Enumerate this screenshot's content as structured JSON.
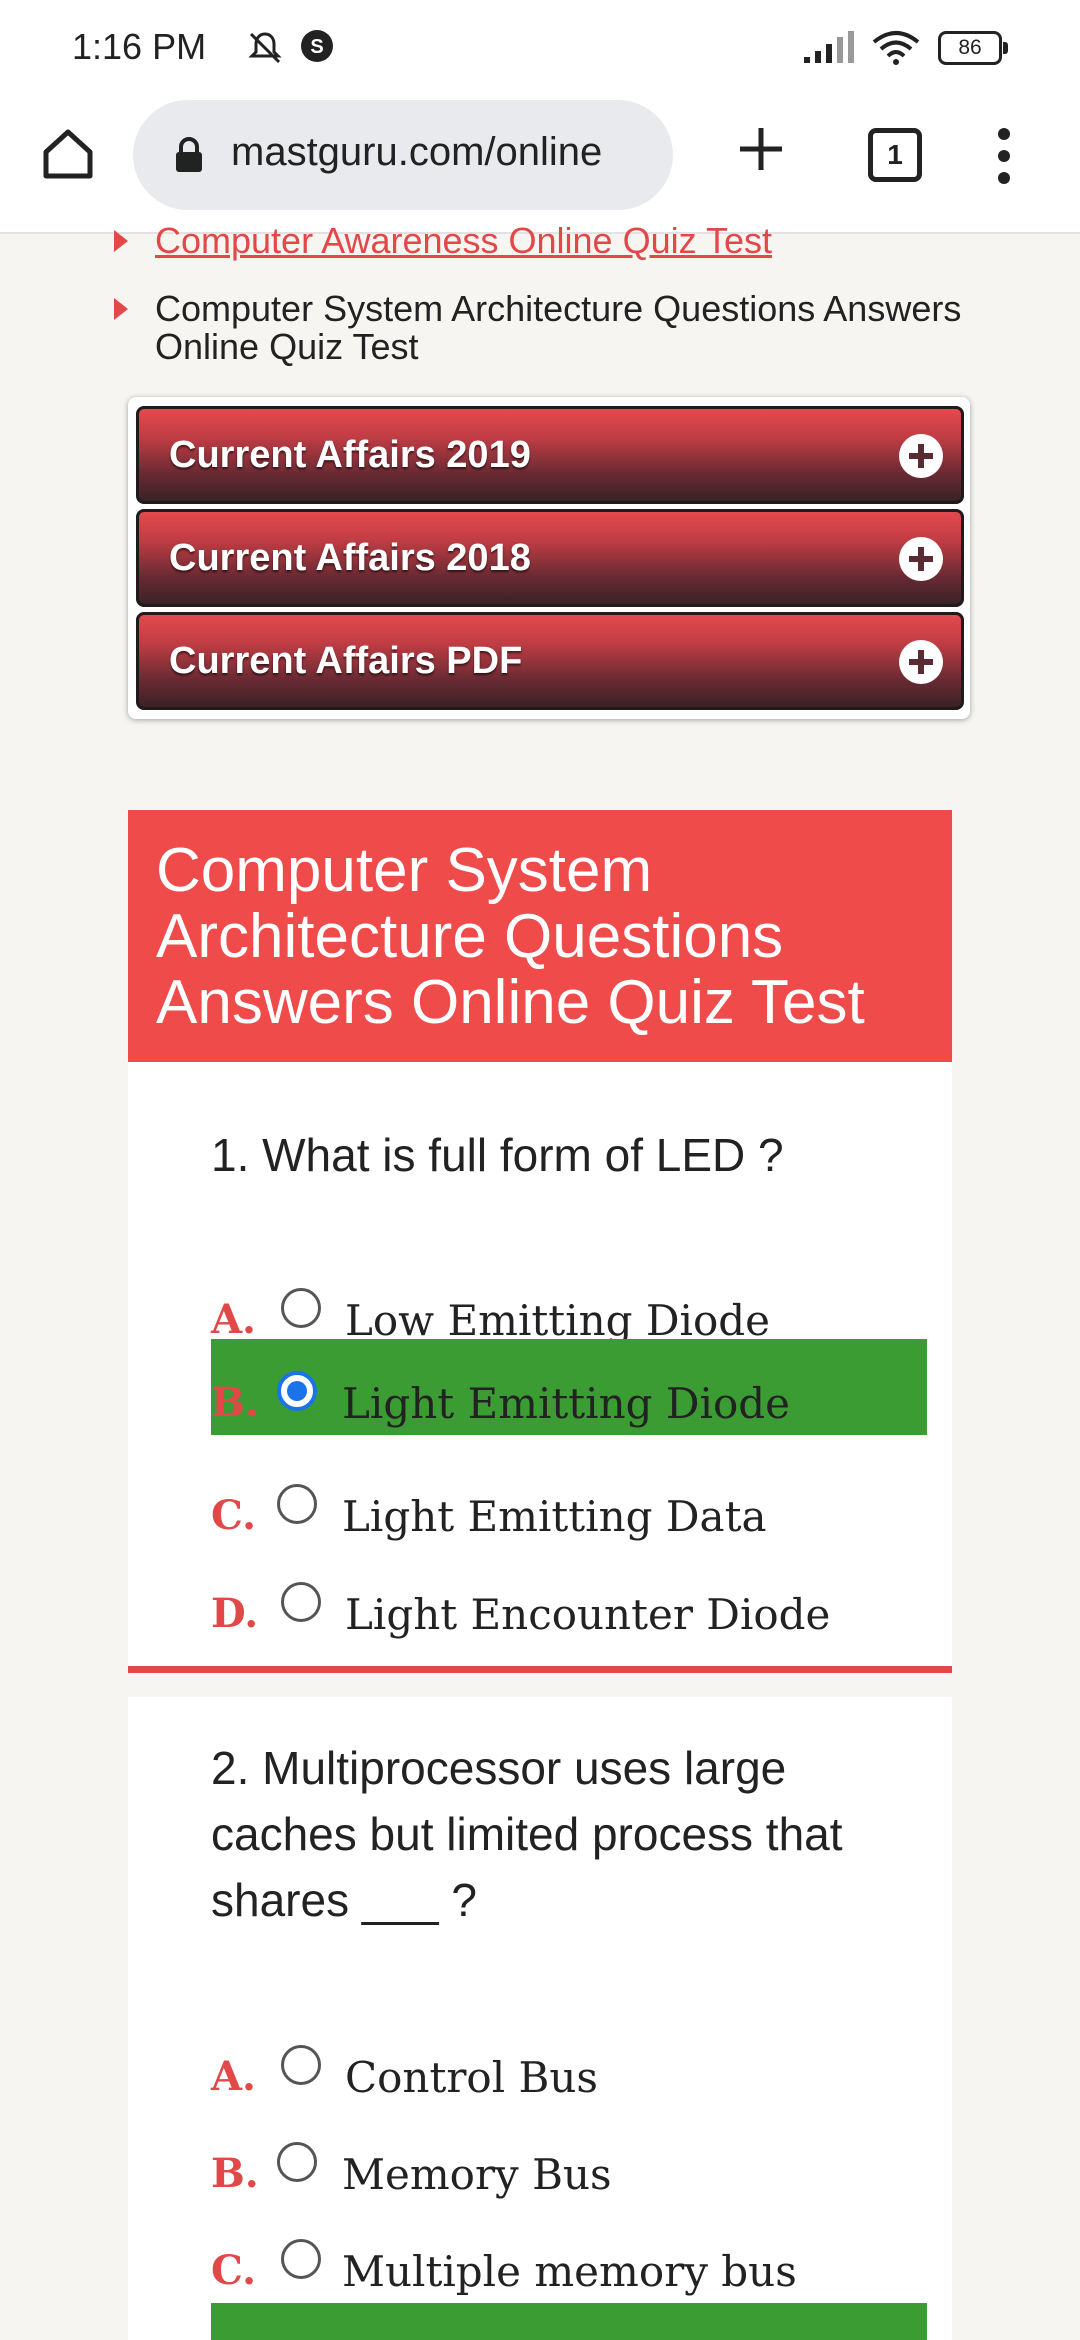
{
  "status": {
    "time": "1:16 PM",
    "battery": "86"
  },
  "browser": {
    "url": "mastguru.com/online",
    "tab_count": "1"
  },
  "links": [
    {
      "label": "Computer Awareness Online Quiz Test"
    },
    {
      "label": "Computer System Architecture Questions Answers Online Quiz Test"
    }
  ],
  "accordion": [
    {
      "label": "Current Affairs 2019"
    },
    {
      "label": "Current Affairs 2018"
    },
    {
      "label": "Current Affairs PDF"
    }
  ],
  "quiz": {
    "title": "Computer System Architecture Questions Answers Online Quiz Test",
    "questions": [
      {
        "text": "1. What is full form of LED ?",
        "options": [
          {
            "letter": "A.",
            "text": "Low Emitting Diode",
            "selected": false
          },
          {
            "letter": "B.",
            "text": "Light Emitting Diode",
            "selected": true
          },
          {
            "letter": "C.",
            "text": "Light Emitting Data",
            "selected": false
          },
          {
            "letter": "D.",
            "text": "Light Encounter Diode",
            "selected": false
          }
        ]
      },
      {
        "text": "2. Multiprocessor uses large caches but limited process that shares ___ ?",
        "options": [
          {
            "letter": "A.",
            "text": "Control Bus",
            "selected": false
          },
          {
            "letter": "B.",
            "text": "Memory Bus",
            "selected": false
          },
          {
            "letter": "C.",
            "text": "Multiple memory bus",
            "selected": false
          }
        ]
      }
    ]
  },
  "colors": {
    "accent": "#e24848",
    "header": "#f04b4b",
    "correct": "#3b9c33",
    "radio_checked": "#1a73e8"
  }
}
